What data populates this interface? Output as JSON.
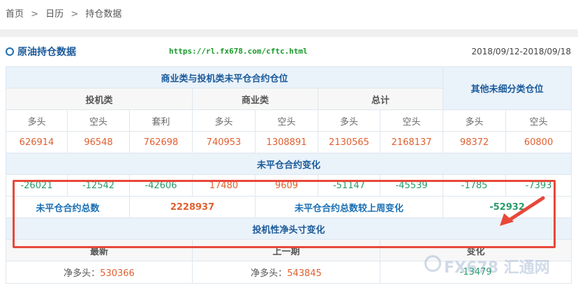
{
  "breadcrumb": {
    "home": "首页",
    "calendar": "日历",
    "current": "持仓数据",
    "sep": ">"
  },
  "header": {
    "title": "原油持仓数据",
    "url": "https://rl.fx678.com/cftc.html",
    "date_range": "2018/09/12-2018/09/18"
  },
  "table": {
    "group_commercial_spec": "商业类与投机类未平仓合约仓位",
    "group_other": "其他未细分类仓位",
    "sub_spec": "投机类",
    "sub_commercial": "商业类",
    "sub_total": "总计",
    "cols": [
      "多头",
      "空头",
      "套利",
      "多头",
      "空头",
      "多头",
      "空头",
      "多头",
      "空头"
    ],
    "positions": [
      "626914",
      "96548",
      "762698",
      "740953",
      "1308891",
      "2130565",
      "2168137",
      "98372",
      "60800"
    ],
    "change_title": "未平仓合约变化",
    "changes": [
      "-26021",
      "-12542",
      "-42606",
      "17480",
      "9609",
      "-51147",
      "-45539",
      "-1785",
      "-7393"
    ],
    "total_label": "未平仓合约总数",
    "total_value": "2228937",
    "week_change_label": "未平仓合约总数较上周变化",
    "week_change_value": "-52932",
    "net_title": "投机性净头寸变化",
    "net_latest": "最新",
    "net_prev": "上一期",
    "net_change": "变化",
    "net_prefix_latest": "净多头：",
    "net_latest_value": "530366",
    "net_prefix_prev": "净多头：",
    "net_prev_value": "543845",
    "net_change_value": "-13479"
  },
  "watermark": "FX678 汇通网",
  "colors": {
    "accent": "#1a6fb4",
    "positive": "#e06030",
    "negative": "#2a9a6a",
    "highlight": "#e8483a"
  }
}
